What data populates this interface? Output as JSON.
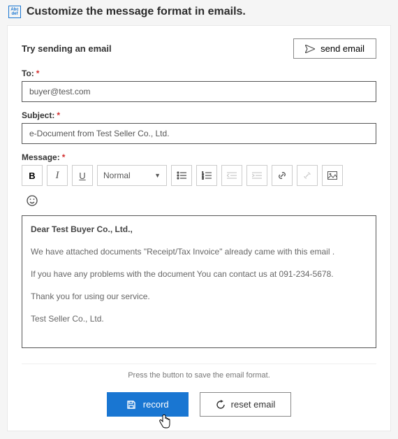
{
  "header": {
    "icon_text_top": "Abc",
    "icon_text_bottom": "def",
    "title": "Customize the message format in emails."
  },
  "try_section": {
    "label": "Try sending an email",
    "send_button": "send email"
  },
  "fields": {
    "to_label": "To:",
    "to_value": "buyer@test.com",
    "subject_label": "Subject:",
    "subject_value": "e-Document from Test Seller Co., Ltd.",
    "message_label": "Message:"
  },
  "toolbar": {
    "bold": "B",
    "italic": "I",
    "underline": "U",
    "format_select": "Normal",
    "caret": "▼"
  },
  "editor": {
    "salutation": "Dear Test Buyer Co., Ltd.,",
    "p1": "We have attached documents \"Receipt/Tax Invoice\" already came with this email .",
    "p2": "If you have any problems with the document You can contact us at 091-234-5678.",
    "p3": "Thank you for using our service.",
    "signature": "Test Seller Co., Ltd."
  },
  "footer": {
    "hint": "Press the button to save the email format.",
    "record_button": "record",
    "reset_button": "reset email"
  }
}
